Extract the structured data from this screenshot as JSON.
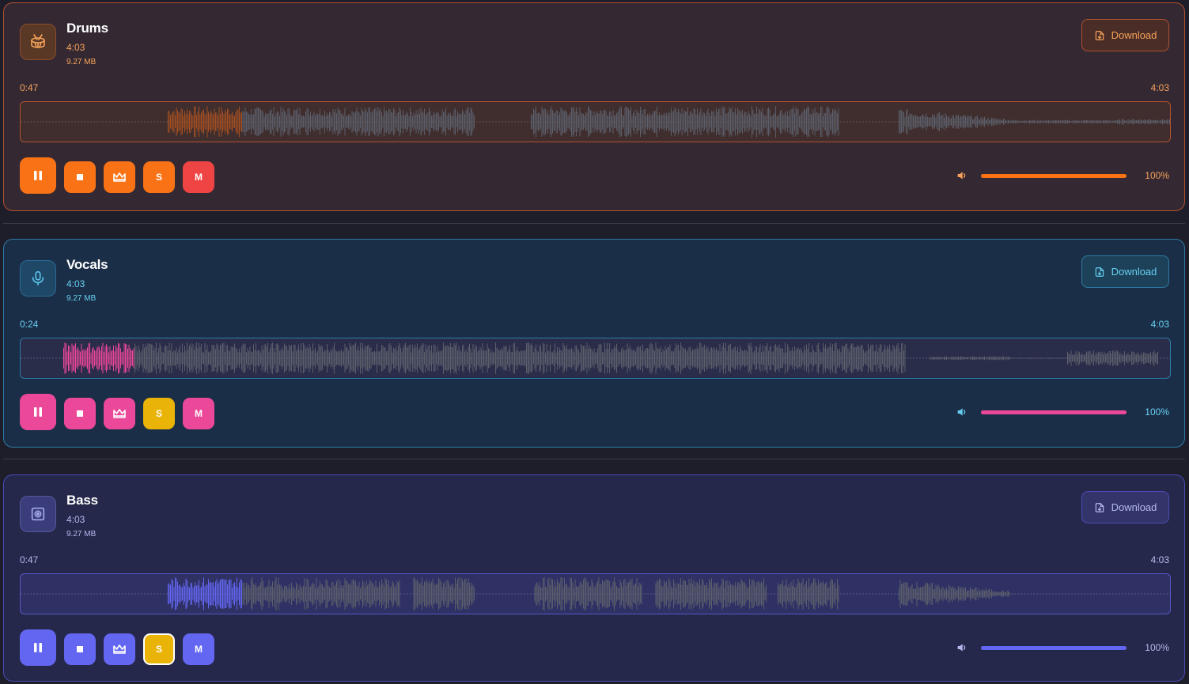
{
  "tracks": [
    {
      "id": "drums",
      "name": "Drums",
      "duration": "4:03",
      "size": "9.27 MB",
      "icon": "drum-icon",
      "download_label": "Download",
      "current_time": "0:47",
      "total_time": "4:03",
      "progress": 0.193,
      "volume_label": "100%",
      "volume": 1.0,
      "solo": false,
      "muted": false,
      "playing": true,
      "accent": "#f97316",
      "played_color": "#a24e22"
    },
    {
      "id": "vocals",
      "name": "Vocals",
      "duration": "4:03",
      "size": "9.27 MB",
      "icon": "microphone-icon",
      "download_label": "Download",
      "current_time": "0:24",
      "total_time": "4:03",
      "progress": 0.099,
      "volume_label": "100%",
      "volume": 1.0,
      "solo": true,
      "muted": false,
      "playing": true,
      "accent": "#ec4899",
      "played_color": "#ec4899"
    },
    {
      "id": "bass",
      "name": "Bass",
      "duration": "4:03",
      "size": "9.27 MB",
      "icon": "speaker-icon",
      "download_label": "Download",
      "current_time": "0:47",
      "total_time": "4:03",
      "progress": 0.193,
      "volume_label": "100%",
      "volume": 1.0,
      "solo": true,
      "muted": false,
      "playing": true,
      "accent": "#6366f1",
      "played_color": "#6366f1"
    }
  ],
  "buttons": {
    "solo_label": "S",
    "mute_label": "M"
  }
}
